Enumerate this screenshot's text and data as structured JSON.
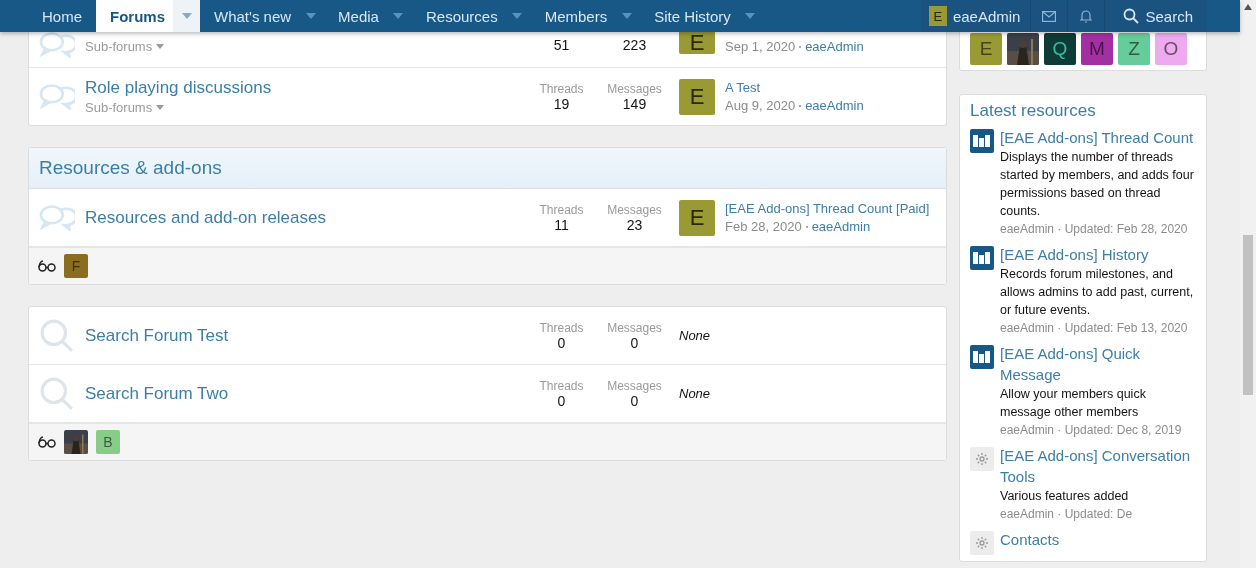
{
  "nav": {
    "tabs": [
      {
        "label": "Home",
        "selected": false,
        "has_menu": false
      },
      {
        "label": "Forums",
        "selected": true,
        "has_menu": true
      },
      {
        "label": "What's new",
        "selected": false,
        "has_menu": true
      },
      {
        "label": "Media",
        "selected": false,
        "has_menu": true
      },
      {
        "label": "Resources",
        "selected": false,
        "has_menu": true
      },
      {
        "label": "Members",
        "selected": false,
        "has_menu": true
      },
      {
        "label": "Site History",
        "selected": false,
        "has_menu": true
      }
    ],
    "user": {
      "initial": "E",
      "name": "eaeAdmin"
    },
    "search_label": "Search"
  },
  "sections": [
    {
      "nodes": [
        {
          "kind": "forum",
          "subforums": "Sub-forums",
          "threads": "51",
          "messages": "223",
          "last_post": {
            "avatar": "E",
            "date": "Sep 1, 2020",
            "user": "eaeAdmin"
          }
        },
        {
          "kind": "forum",
          "title": "Role playing discussions",
          "subforums": "Sub-forums",
          "threads_label": "Threads",
          "threads": "19",
          "messages_label": "Messages",
          "messages": "149",
          "last_post": {
            "avatar": "E",
            "title": "A Test",
            "date": "Aug 9, 2020",
            "user": "eaeAdmin"
          }
        }
      ]
    },
    {
      "title": "Resources & add-ons",
      "nodes": [
        {
          "kind": "forum",
          "title": "Resources and add-on releases",
          "threads_label": "Threads",
          "threads": "11",
          "messages_label": "Messages",
          "messages": "23",
          "last_post": {
            "avatar": "E",
            "title": "[EAE Add-ons] Thread Count [Paid]",
            "date": "Feb 28, 2020",
            "user": "eaeAdmin"
          }
        }
      ],
      "footer": [
        {
          "kind": "letter",
          "letter": "F",
          "color": "#8c6d1f"
        }
      ]
    },
    {
      "nodes": [
        {
          "kind": "search",
          "title": "Search Forum Test",
          "threads_label": "Threads",
          "threads": "0",
          "messages_label": "Messages",
          "messages": "0",
          "none_text": "None"
        },
        {
          "kind": "search",
          "title": "Search Forum Two",
          "threads_label": "Threads",
          "threads": "0",
          "messages_label": "Messages",
          "messages": "0",
          "none_text": "None"
        }
      ],
      "footer": [
        {
          "kind": "picture"
        },
        {
          "kind": "letter",
          "letter": "B",
          "color": "#88cc88"
        }
      ]
    }
  ],
  "sidebar": {
    "online": [
      {
        "kind": "letter",
        "letter": "E",
        "color": "#9a9a34"
      },
      {
        "kind": "picture"
      },
      {
        "kind": "letter",
        "letter": "Q",
        "color": "#0e3b36"
      },
      {
        "kind": "letter",
        "letter": "M",
        "color": "#a330a3"
      },
      {
        "kind": "letter",
        "letter": "Z",
        "color": "#66cc99"
      },
      {
        "kind": "letter",
        "letter": "O",
        "color": "#eeaaee"
      }
    ],
    "resources": {
      "title": "Latest resources",
      "items": [
        {
          "kind": "logo",
          "title": "[EAE Add-ons] Thread Count",
          "description": "Displays the number of threads started by members, and adds four permissions based on thread counts.",
          "meta": "eaeAdmin · Updated: Feb 28, 2020"
        },
        {
          "kind": "logo",
          "title": "[EAE Add-ons] History",
          "description": "Records forum milestones, and allows admins to add past, current, or future events.",
          "meta": "eaeAdmin · Updated: Feb 13, 2020"
        },
        {
          "kind": "logo",
          "title": "[EAE Add-ons] Quick Message",
          "description": "Allow your members quick message other members",
          "meta": "eaeAdmin · Updated: Dec 8, 2019"
        },
        {
          "kind": "gear",
          "title": "[EAE Add-ons] Conversation Tools",
          "description": "Various features added",
          "meta": "eaeAdmin · Updated: De"
        },
        {
          "kind": "gear",
          "title": "Contacts"
        }
      ]
    }
  }
}
